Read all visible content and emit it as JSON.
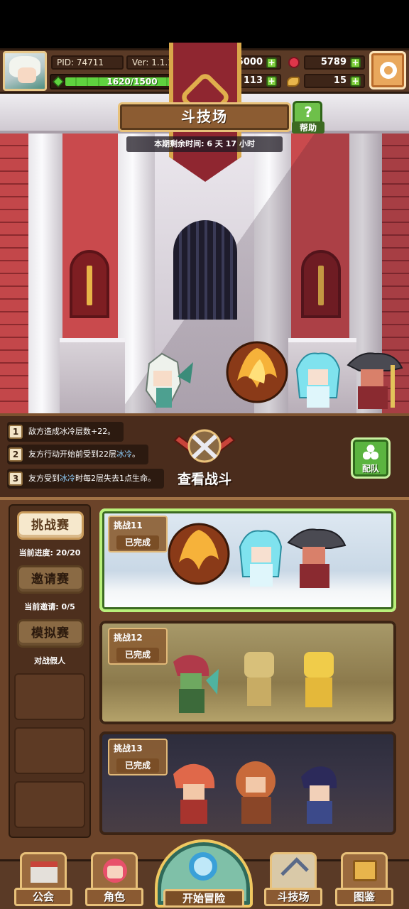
{
  "player": {
    "pid": "PID: 74711",
    "version": "Ver: 1.1.1.8",
    "xp": "1620/1500"
  },
  "resources": {
    "gold": "275000",
    "gems": "5789",
    "clover": "113",
    "bread": "15"
  },
  "arena": {
    "title": "斗技场",
    "help_label": "帮助",
    "timer": "本期剩余时间: 6 天 17 小时"
  },
  "buffs": [
    {
      "num": "1",
      "text_a": "敌方造成冰冷层数+22。",
      "text_b": "",
      "text_c": ""
    },
    {
      "num": "2",
      "text_a": "友方行动开始前受到22层",
      "text_b": "冰冷",
      "text_c": "。"
    },
    {
      "num": "3",
      "text_a": "友方受到",
      "text_b": "冰冷",
      "text_c": "时每2层失去1点生命。"
    }
  ],
  "view_battle": "查看战斗",
  "team_label": "配队",
  "modes": [
    {
      "label": "挑战赛",
      "sub": "当前进度: 20/20"
    },
    {
      "label": "邀请赛",
      "sub": "当前邀请: 0/5"
    },
    {
      "label": "模拟赛",
      "sub": "对战假人"
    }
  ],
  "challenges": [
    {
      "name": "挑战11",
      "status": "已完成"
    },
    {
      "name": "挑战12",
      "status": "已完成"
    },
    {
      "name": "挑战13",
      "status": "已完成"
    }
  ],
  "nav": {
    "guild": "公会",
    "character": "角色",
    "adventure": "开始冒险",
    "arena": "斗技场",
    "codex": "图鉴"
  },
  "colors": {
    "accent_green": "#6ec04a",
    "frame_gold": "#e8c17a",
    "panel_brown": "#5a3a26"
  }
}
